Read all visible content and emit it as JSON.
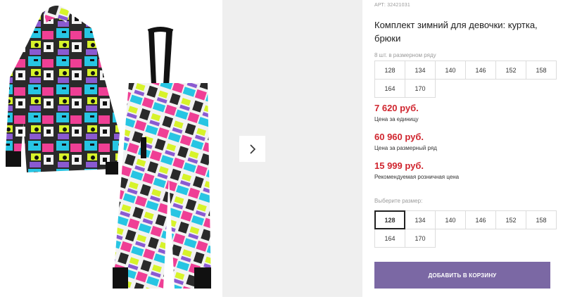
{
  "product": {
    "article": "АРТ: 32421031",
    "title": "Комплект зимний для девочки: куртка, брюки"
  },
  "pack": {
    "label": "8 шт. в размерном ряду",
    "sizes": [
      "128",
      "134",
      "140",
      "146",
      "152",
      "158",
      "164",
      "170"
    ]
  },
  "prices": [
    {
      "value": "7 620 руб.",
      "note": "Цена за единицу"
    },
    {
      "value": "60 960 руб.",
      "note": "Цена за размерный ряд"
    },
    {
      "value": "15 999 руб.",
      "note": "Рекомендуемая розничная цена"
    }
  ],
  "size_select": {
    "label": "Выберите размер:",
    "selected": "128",
    "sizes": [
      "128",
      "134",
      "140",
      "146",
      "152",
      "158",
      "164",
      "170"
    ]
  },
  "cart_button": "Добавить в корзину",
  "gallery": {
    "next_icon": "chevron-right-icon"
  },
  "colors": {
    "price": "#d0252e",
    "button": "#7b68a4"
  }
}
